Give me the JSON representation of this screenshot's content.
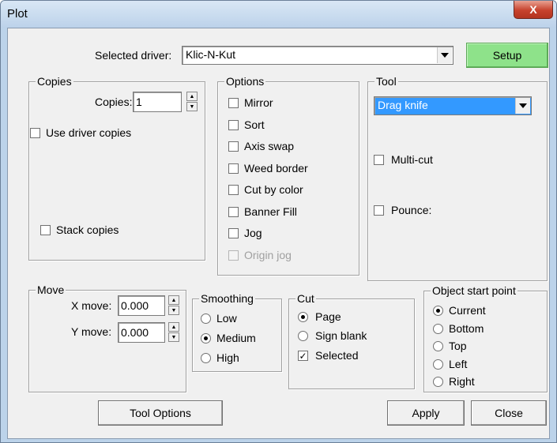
{
  "window": {
    "title": "Plot",
    "close_glyph": "X"
  },
  "driver": {
    "label": "Selected driver:",
    "value": "Klic-N-Kut",
    "setup_label": "Setup",
    "setup_color": "#8ee28a"
  },
  "copies": {
    "legend": "Copies",
    "copies_label": "Copies:",
    "copies_value": "1",
    "use_driver_copies": "Use driver copies",
    "use_driver_copies_checked": false,
    "stack_copies": "Stack copies",
    "stack_copies_checked": false
  },
  "options": {
    "legend": "Options",
    "items": [
      {
        "label": "Mirror",
        "checked": false,
        "enabled": true
      },
      {
        "label": "Sort",
        "checked": false,
        "enabled": true
      },
      {
        "label": "Axis swap",
        "checked": false,
        "enabled": true
      },
      {
        "label": "Weed border",
        "checked": false,
        "enabled": true
      },
      {
        "label": "Cut by color",
        "checked": false,
        "enabled": true
      },
      {
        "label": "Banner Fill",
        "checked": false,
        "enabled": true
      },
      {
        "label": "Jog",
        "checked": false,
        "enabled": true
      },
      {
        "label": "Origin jog",
        "checked": false,
        "enabled": false
      }
    ]
  },
  "tool": {
    "legend": "Tool",
    "selected": "Drag knife",
    "selected_color": "#3399ff",
    "multi_cut": "Multi-cut",
    "pounce": "Pounce:"
  },
  "move": {
    "legend": "Move",
    "x_label": "X move:",
    "x_value": "0.000",
    "y_label": "Y move:",
    "y_value": "0.000"
  },
  "smoothing": {
    "legend": "Smoothing",
    "options": [
      "Low",
      "Medium",
      "High"
    ],
    "selected": "Medium"
  },
  "cut": {
    "legend": "Cut",
    "page": "Page",
    "sign_blank": "Sign blank",
    "selected_label": "Selected",
    "selected_option": "Page",
    "selected_checked": true
  },
  "start_point": {
    "legend": "Object start point",
    "options": [
      "Current",
      "Bottom",
      "Top",
      "Left",
      "Right"
    ],
    "selected": "Current"
  },
  "buttons": {
    "tool_options": "Tool Options",
    "apply": "Apply",
    "close": "Close"
  }
}
